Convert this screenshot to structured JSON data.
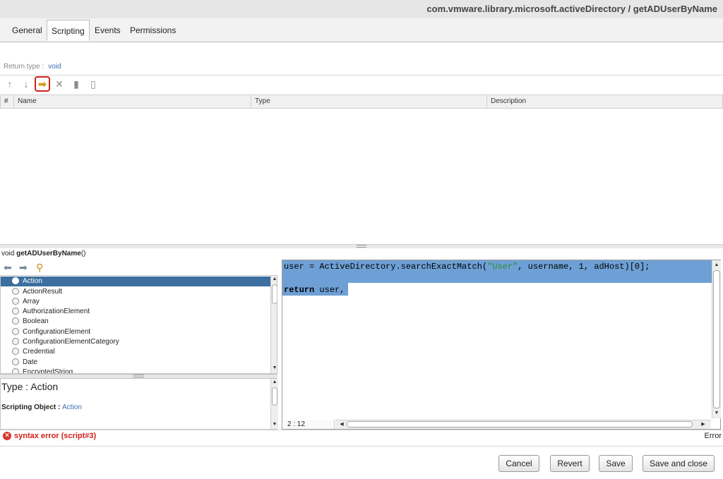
{
  "title": "com.vmware.library.microsoft.activeDirectory / getADUserByName",
  "tabs": [
    {
      "label": "General"
    },
    {
      "label": "Scripting"
    },
    {
      "label": "Events"
    },
    {
      "label": "Permissions"
    }
  ],
  "return_type": {
    "label": "Return type :",
    "value": "void"
  },
  "param_table": {
    "columns": [
      "#",
      "Name",
      "Type",
      "Description"
    ]
  },
  "signature": {
    "prefix": "void ",
    "name": "getADUserByName",
    "suffix": "()"
  },
  "type_list": {
    "selected": "Action",
    "items": [
      "Action",
      "ActionResult",
      "Array",
      "AuthorizationElement",
      "Boolean",
      "ConfigurationElement",
      "ConfigurationElementCategory",
      "Credential",
      "Date",
      "EncryptedString"
    ]
  },
  "type_details": {
    "type_label": "Type : ",
    "type_value": "Action",
    "scripting_object_label": "Scripting Object : ",
    "scripting_object_value": "Action"
  },
  "editor": {
    "line1_a": "user = ActiveDirectory.searchExactMatch(",
    "line1_str": "\"User\"",
    "line1_b": ", username, 1, adHost)[0];",
    "line3_kw": "return",
    "line3_rest": " user,",
    "cursor_position": "2 : 12"
  },
  "status": {
    "error_text": "syntax error (script#3)",
    "right_text": "Error"
  },
  "buttons": {
    "cancel": "Cancel",
    "revert": "Revert",
    "save": "Save",
    "save_close": "Save and close"
  },
  "colors": {
    "accent_red": "#d0201a",
    "selection": "#6ea0d5",
    "list_selected": "#3c6e9f",
    "link_blue": "#3b6fb5"
  }
}
